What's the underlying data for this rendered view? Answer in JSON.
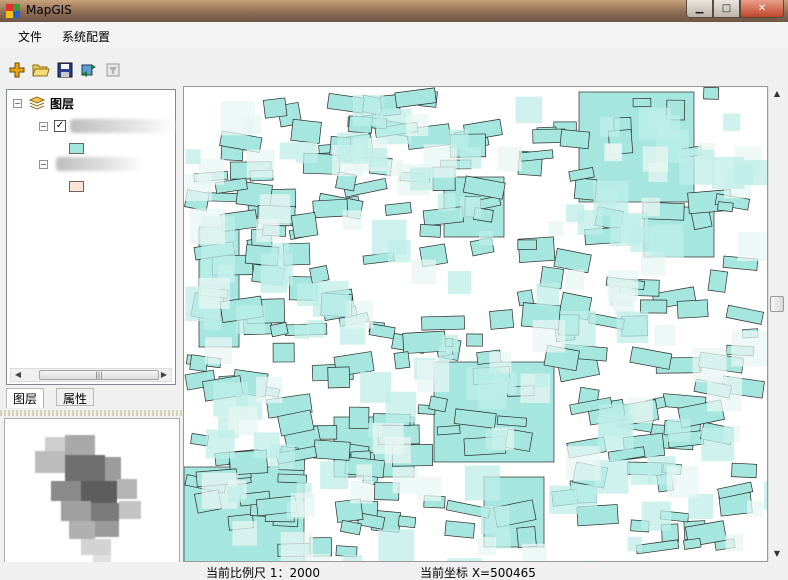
{
  "window": {
    "title": "MapGIS"
  },
  "menu": {
    "items": [
      {
        "label": "文件"
      },
      {
        "label": "系统配置"
      }
    ]
  },
  "toolbar": {
    "icons": [
      "add-layer-icon",
      "open-folder-icon",
      "save-icon",
      "refresh-icon",
      "filter-icon"
    ]
  },
  "layer_tree": {
    "root_label": "图层",
    "layers": [
      {
        "checked": true,
        "fill": "#a5e6df"
      },
      {
        "checked": false,
        "fill": "#fbe3d6"
      }
    ]
  },
  "tabs": [
    {
      "label": "图层"
    },
    {
      "label": "属性"
    }
  ],
  "status": {
    "scale": "当前比例尺 1：2000",
    "coords": "当前坐标 X=500465"
  },
  "colors": {
    "parcel_fill": "#a5e6df",
    "parcel_stroke": "#2a2a2a",
    "swatch_2": "#fbe3d6"
  }
}
